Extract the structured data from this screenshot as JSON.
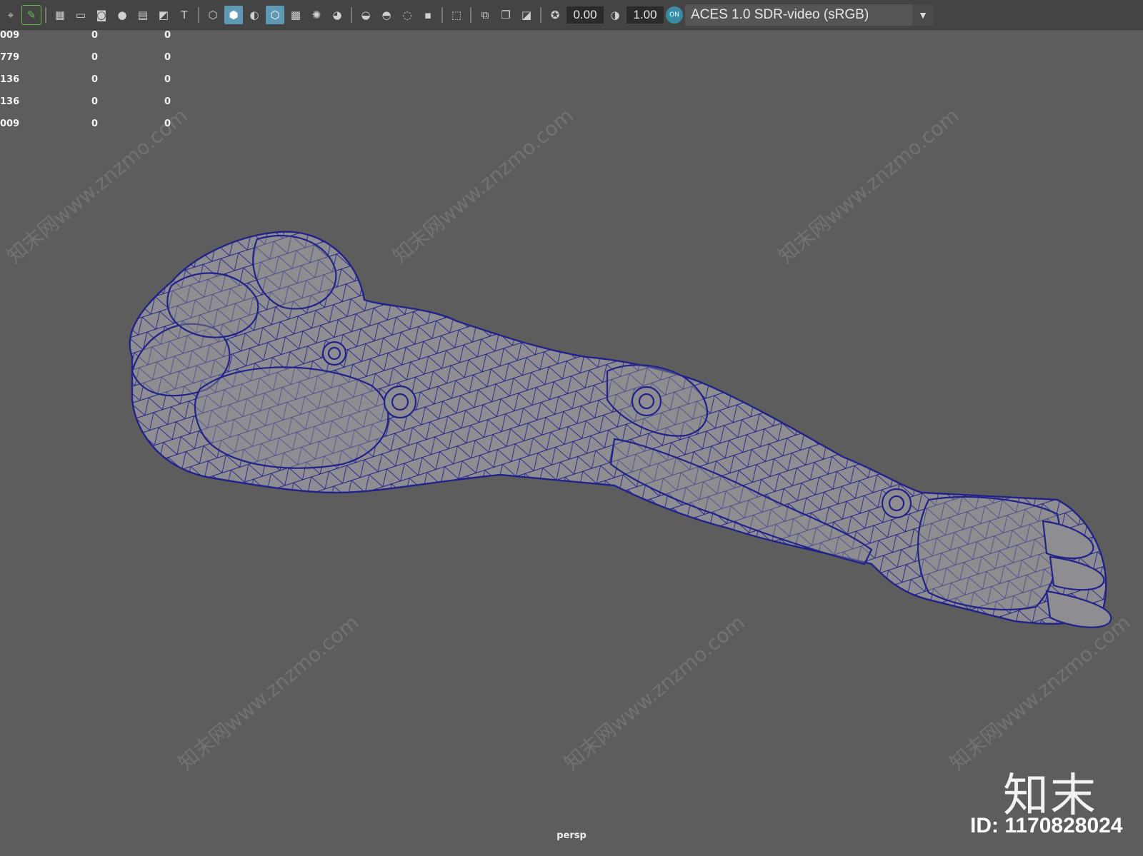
{
  "toolbar": {
    "exposure_value": "0.00",
    "gamma_value": "1.00",
    "color_management_toggle": "ON",
    "view_transform": "ACES 1.0 SDR-video (sRGB)"
  },
  "hud": {
    "rows": [
      {
        "a": "009",
        "b": "0",
        "c": "0"
      },
      {
        "a": "779",
        "b": "0",
        "c": "0"
      },
      {
        "a": "136",
        "b": "0",
        "c": "0"
      },
      {
        "a": "136",
        "b": "0",
        "c": "0"
      },
      {
        "a": "009",
        "b": "0",
        "c": "0"
      }
    ]
  },
  "viewport": {
    "camera": "persp",
    "mesh_wire_color": "#22228a",
    "mesh_fill_color": "#8e8e92"
  },
  "watermark": {
    "logo": "知末",
    "id": "ID: 1170828024",
    "diagonal_text": "知末网www.znzmo.com"
  }
}
